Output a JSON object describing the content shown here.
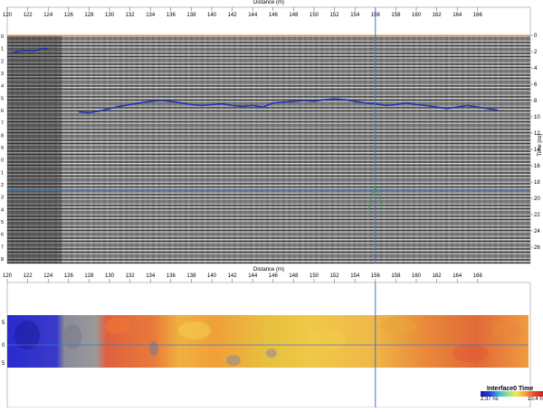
{
  "app": {
    "colors": {
      "cursor": "#3a78c8",
      "interface": "#2432b8",
      "surface_line": "#f0a040",
      "wavelet": "#3fa046"
    }
  },
  "top_panel": {
    "x_axis_title": "Distance (m)",
    "x_ticks": [
      "120",
      "122",
      "124",
      "126",
      "128",
      "130",
      "132",
      "134",
      "136",
      "138",
      "140",
      "142",
      "144",
      "146",
      "148",
      "150",
      "152",
      "154",
      "156",
      "158",
      "160",
      "162",
      "164",
      "166"
    ],
    "right_axis_title": "Time (ns)",
    "right_ticks": [
      "0",
      "2",
      "4",
      "6",
      "8",
      "10",
      "12",
      "14",
      "16",
      "18",
      "20",
      "22",
      "24",
      "26"
    ],
    "left_ticks": [
      "0",
      "1",
      "2",
      "3",
      "4",
      "5",
      "6",
      "7",
      "8",
      "9",
      "0",
      "1",
      "2",
      "3",
      "4",
      "5",
      "6",
      "7",
      "8"
    ]
  },
  "bottom_panel": {
    "x_axis_title": "Distance (m)",
    "x_ticks": [
      "120",
      "122",
      "124",
      "126",
      "128",
      "130",
      "132",
      "134",
      "136",
      "138",
      "140",
      "142",
      "144",
      "146",
      "148",
      "150",
      "152",
      "154",
      "156",
      "158",
      "160",
      "162",
      "164",
      "166"
    ],
    "left_ticks": [
      "5",
      "0",
      "5"
    ]
  },
  "legend": {
    "title": "Interface0 Time",
    "min_label": "2.37 ns",
    "max_label": "10.4 ns",
    "icon": "color-scale-bar"
  },
  "cursor": {
    "distance_m": 156.0
  },
  "interface_pick": {
    "segment1": [
      [
        120.5,
        2.2
      ],
      [
        121,
        2.0
      ],
      [
        121.5,
        1.9
      ],
      [
        122,
        1.9
      ],
      [
        122.5,
        1.95
      ],
      [
        123,
        1.8
      ],
      [
        123.5,
        1.6
      ],
      [
        124,
        1.7
      ]
    ],
    "segment2": [
      [
        127,
        9.4
      ],
      [
        128,
        9.5
      ],
      [
        129,
        9.3
      ],
      [
        130,
        9.0
      ],
      [
        131,
        8.7
      ],
      [
        132,
        8.5
      ],
      [
        133,
        8.3
      ],
      [
        134,
        8.1
      ],
      [
        135,
        8.0
      ],
      [
        136,
        8.1
      ],
      [
        137,
        8.3
      ],
      [
        138,
        8.5
      ],
      [
        139,
        8.6
      ],
      [
        140,
        8.5
      ],
      [
        141,
        8.4
      ],
      [
        142,
        8.6
      ],
      [
        143,
        8.7
      ],
      [
        144,
        8.6
      ],
      [
        145,
        8.8
      ],
      [
        146,
        8.3
      ],
      [
        147,
        8.2
      ],
      [
        148,
        8.1
      ],
      [
        149,
        8.0
      ],
      [
        150,
        8.1
      ],
      [
        151,
        7.9
      ],
      [
        152,
        7.8
      ],
      [
        153,
        7.9
      ],
      [
        154,
        8.1
      ],
      [
        155,
        8.3
      ],
      [
        156,
        8.4
      ],
      [
        157,
        8.6
      ],
      [
        158,
        8.5
      ],
      [
        159,
        8.3
      ],
      [
        160,
        8.5
      ],
      [
        161,
        8.6
      ],
      [
        162,
        8.8
      ],
      [
        163,
        9.0
      ],
      [
        164,
        8.8
      ],
      [
        165,
        8.6
      ],
      [
        166,
        8.8
      ],
      [
        167,
        9.0
      ],
      [
        168,
        9.2
      ]
    ]
  },
  "horizontal_marker_time_ns": 19.0
}
